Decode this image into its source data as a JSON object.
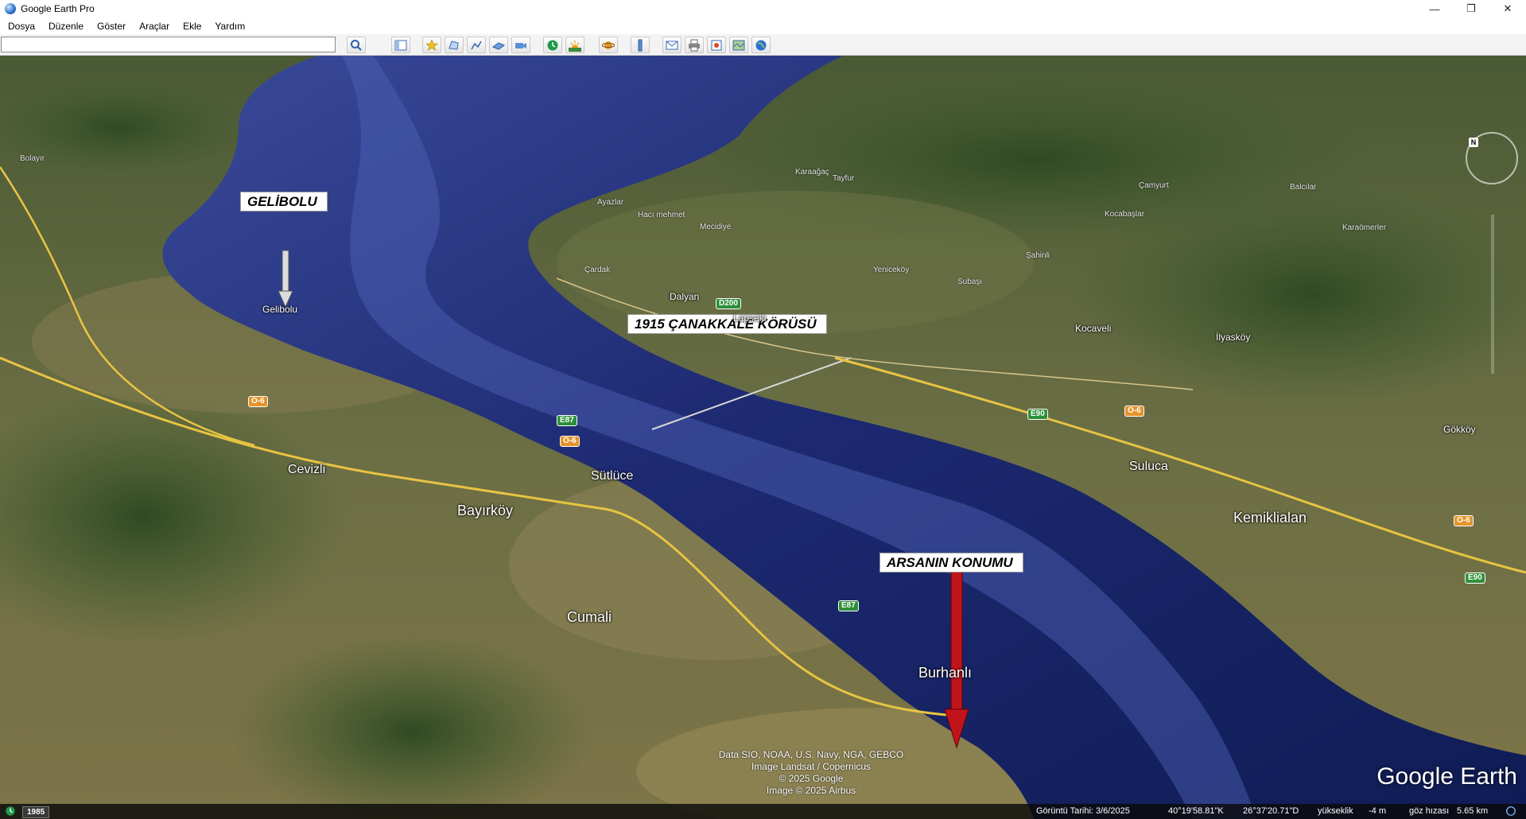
{
  "window": {
    "title": "Google Earth Pro",
    "controls": [
      "—",
      "❐",
      "✕"
    ]
  },
  "menu": [
    "Dosya",
    "Düzenle",
    "Göster",
    "Araçlar",
    "Ekle",
    "Yardım"
  ],
  "search": {
    "value": "",
    "placeholder": ""
  },
  "toolbar_icons": [
    "search-icon",
    "sidebar-toggle-icon",
    "add-placemark-icon",
    "add-polygon-icon",
    "add-path-icon",
    "add-image-overlay-icon",
    "record-tour-icon",
    "historical-imagery-icon",
    "sun-icon",
    "planets-icon",
    "ruler-icon",
    "email-icon",
    "print-icon",
    "save-image-icon",
    "view-in-maps-icon",
    "earth-icon"
  ],
  "callouts": {
    "gelibolu": "GELİBOLU",
    "bridge": "1915 ÇANAKKALE KÖRÜSÜ",
    "plot": "ARSANIN KONUMU"
  },
  "places": {
    "gelibolu_town": "Gelibolu",
    "cevizli": "Cevizli",
    "bayirkoy": "Bayırköy",
    "sutluce": "Sütlüce",
    "cumali": "Cumali",
    "burhanli": "Burhanlı",
    "dalyan": "Dalyan",
    "lapseki": "Lapseki",
    "kocaveli": "Kocaveli",
    "ilyaskoy": "İlyasköy",
    "suluca": "Suluca",
    "kemiklialan": "Kemiklialan",
    "gokkoy": "Gökköy",
    "yenicekoy": "Yeniceköy",
    "subasi": "Subaşı",
    "sahinli": "Şahinli",
    "cardak": "Çardak",
    "mecidiye": "Mecidiye",
    "hacimemet": "Hacı mehmet",
    "kocabaslar": "Kocabaşlar",
    "karacamerler": "Karaömerler",
    "ayazlar": "Ayazlar",
    "camyurt": "Çamyurt",
    "tayfur": "Tayfur",
    "karaagac": "Karaağaç",
    "balcilar": "Balcılar",
    "bolayir": "Bolayır"
  },
  "roads": {
    "e87": "E87",
    "e90": "E90",
    "o6": "O-6",
    "d200": "D200"
  },
  "copyright": [
    "Data SIO, NOAA, U.S. Navy, NGA, GEBCO",
    "Image Landsat / Copernicus",
    "© 2025 Google",
    "Image © 2025 Airbus"
  ],
  "brand": "Google Earth",
  "status": {
    "history_year": "1985",
    "imagery_date": "Görüntü Tarihi: 3/6/2025",
    "lat": "40°19'58.81\"K",
    "lon": "26°37'20.71\"D",
    "elevation_label": "yükseklik",
    "elevation": "-4 m",
    "eye_label": "göz hızası",
    "eye_alt": "5.65 km"
  },
  "nav": {
    "north": "N"
  },
  "colors": {
    "sea": "#1b2a6e",
    "land": "#5b6a3c",
    "callout_arrow_plot": "#c0141c",
    "callout_arrow_gelibolu": "#dcdcdc",
    "road": "#e8c442"
  }
}
